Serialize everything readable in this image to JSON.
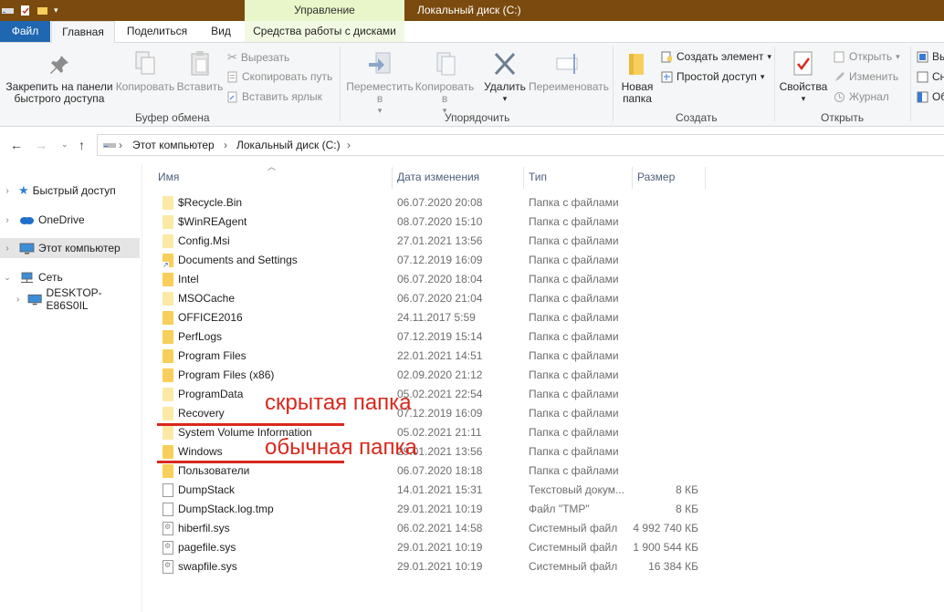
{
  "titlebar": {
    "context_tab": "Управление",
    "window_title": "Локальный диск (C:)"
  },
  "tabs": {
    "file": "Файл",
    "home": "Главная",
    "share": "Поделиться",
    "view": "Вид",
    "disk_tools": "Средства работы с дисками"
  },
  "ribbon": {
    "pin": "Закрепить на панели быстрого доступа",
    "copy": "Копировать",
    "paste": "Вставить",
    "cut": "Вырезать",
    "copy_path": "Скопировать путь",
    "paste_shortcut": "Вставить ярлык",
    "group_clipboard": "Буфер обмена",
    "move_to": "Переместить в",
    "copy_to": "Копировать в",
    "delete": "Удалить",
    "rename": "Переименовать",
    "group_organize": "Упорядочить",
    "new_folder": "Новая папка",
    "new_item": "Создать элемент",
    "easy_access": "Простой доступ",
    "group_new": "Создать",
    "properties": "Свойства",
    "open": "Открыть",
    "edit": "Изменить",
    "history": "Журнал",
    "group_open": "Открыть",
    "sel_1": "Вы",
    "sel_2": "Сн",
    "sel_3": "Об"
  },
  "address": {
    "crumb1": "Этот компьютер",
    "crumb2": "Локальный диск (C:)"
  },
  "nav": {
    "quick_access": "Быстрый доступ",
    "onedrive": "OneDrive",
    "this_pc": "Этот компьютер",
    "network": "Сеть",
    "desktop": "DESKTOP-E86S0IL"
  },
  "columns": {
    "name": "Имя",
    "date": "Дата изменения",
    "type": "Тип",
    "size": "Размер"
  },
  "files": [
    {
      "name": "$Recycle.Bin",
      "date": "06.07.2020 20:08",
      "type": "Папка с файлами",
      "size": "",
      "icon": "folder-hidden"
    },
    {
      "name": "$WinREAgent",
      "date": "08.07.2020 15:10",
      "type": "Папка с файлами",
      "size": "",
      "icon": "folder-hidden"
    },
    {
      "name": "Config.Msi",
      "date": "27.01.2021 13:56",
      "type": "Папка с файлами",
      "size": "",
      "icon": "folder-hidden"
    },
    {
      "name": "Documents and Settings",
      "date": "07.12.2019 16:09",
      "type": "Папка с файлами",
      "size": "",
      "icon": "folder-link"
    },
    {
      "name": "Intel",
      "date": "06.07.2020 18:04",
      "type": "Папка с файлами",
      "size": "",
      "icon": "folder"
    },
    {
      "name": "MSOCache",
      "date": "06.07.2020 21:04",
      "type": "Папка с файлами",
      "size": "",
      "icon": "folder-hidden"
    },
    {
      "name": "OFFICE2016",
      "date": "24.11.2017 5:59",
      "type": "Папка с файлами",
      "size": "",
      "icon": "folder"
    },
    {
      "name": "PerfLogs",
      "date": "07.12.2019 15:14",
      "type": "Папка с файлами",
      "size": "",
      "icon": "folder"
    },
    {
      "name": "Program Files",
      "date": "22.01.2021 14:51",
      "type": "Папка с файлами",
      "size": "",
      "icon": "folder"
    },
    {
      "name": "Program Files (x86)",
      "date": "02.09.2020 21:12",
      "type": "Папка с файлами",
      "size": "",
      "icon": "folder"
    },
    {
      "name": "ProgramData",
      "date": "05.02.2021 22:54",
      "type": "Папка с файлами",
      "size": "",
      "icon": "folder-hidden"
    },
    {
      "name": "Recovery",
      "date": "07.12.2019 16:09",
      "type": "Папка с файлами",
      "size": "",
      "icon": "folder-hidden"
    },
    {
      "name": "System Volume Information",
      "date": "05.02.2021 21:11",
      "type": "Папка с файлами",
      "size": "",
      "icon": "folder-hidden"
    },
    {
      "name": "Windows",
      "date": "29.01.2021 13:56",
      "type": "Папка с файлами",
      "size": "",
      "icon": "folder"
    },
    {
      "name": "Пользователи",
      "date": "06.07.2020 18:18",
      "type": "Папка с файлами",
      "size": "",
      "icon": "folder"
    },
    {
      "name": "DumpStack",
      "date": "14.01.2021 15:31",
      "type": "Текстовый докум...",
      "size": "8 КБ",
      "icon": "file"
    },
    {
      "name": "DumpStack.log.tmp",
      "date": "29.01.2021 10:19",
      "type": "Файл \"TMP\"",
      "size": "8 КБ",
      "icon": "file"
    },
    {
      "name": "hiberfil.sys",
      "date": "06.02.2021 14:58",
      "type": "Системный файл",
      "size": "4 992 740 КБ",
      "icon": "sysfile"
    },
    {
      "name": "pagefile.sys",
      "date": "29.01.2021 10:19",
      "type": "Системный файл",
      "size": "1 900 544 КБ",
      "icon": "sysfile"
    },
    {
      "name": "swapfile.sys",
      "date": "29.01.2021 10:19",
      "type": "Системный файл",
      "size": "16 384 КБ",
      "icon": "sysfile"
    }
  ],
  "annotations": {
    "hidden": "скрытая папка",
    "normal": "обычная папка"
  },
  "colors": {
    "titlebar": "#7a4a0e",
    "file_tab": "#1f67b1",
    "annotation": "#d9281c",
    "folder": "#f7cf5a"
  }
}
